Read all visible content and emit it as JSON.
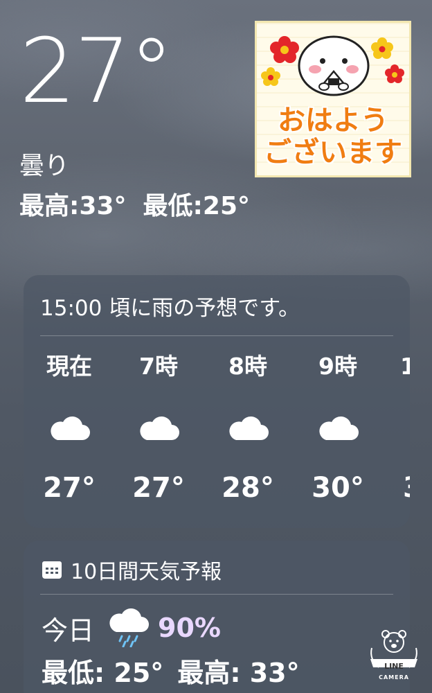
{
  "current": {
    "temperature": "27°",
    "condition": "曇り",
    "high": "最高:33°",
    "low": "最低:25°"
  },
  "sticker": {
    "line1": "おはよう",
    "line2": "ございます",
    "colors": {
      "text": "#f07d12",
      "flower_red": "#e3262a",
      "flower_yellow": "#f6c61a",
      "cheek": "#f5a3b0"
    }
  },
  "hourly": {
    "summary": "15:00 頃に雨の予想です。",
    "items": [
      {
        "time": "現在",
        "icon": "cloud-icon",
        "temp": "27°"
      },
      {
        "time": "7時",
        "icon": "cloud-icon",
        "temp": "27°"
      },
      {
        "time": "8時",
        "icon": "cloud-icon",
        "temp": "28°"
      },
      {
        "time": "9時",
        "icon": "cloud-icon",
        "temp": "30°"
      },
      {
        "time": "1",
        "icon": "cloud-icon",
        "temp": "3"
      }
    ]
  },
  "daily": {
    "icon": "calendar-icon",
    "title": "10日間天気予報",
    "days": [
      {
        "day": "今日",
        "icon": "rain-cloud-icon",
        "precip": "90%",
        "low": "最低: 25°",
        "high": "最高: 33°"
      }
    ]
  },
  "watermark": {
    "line1": "LINE",
    "line2": "CAMERA"
  }
}
